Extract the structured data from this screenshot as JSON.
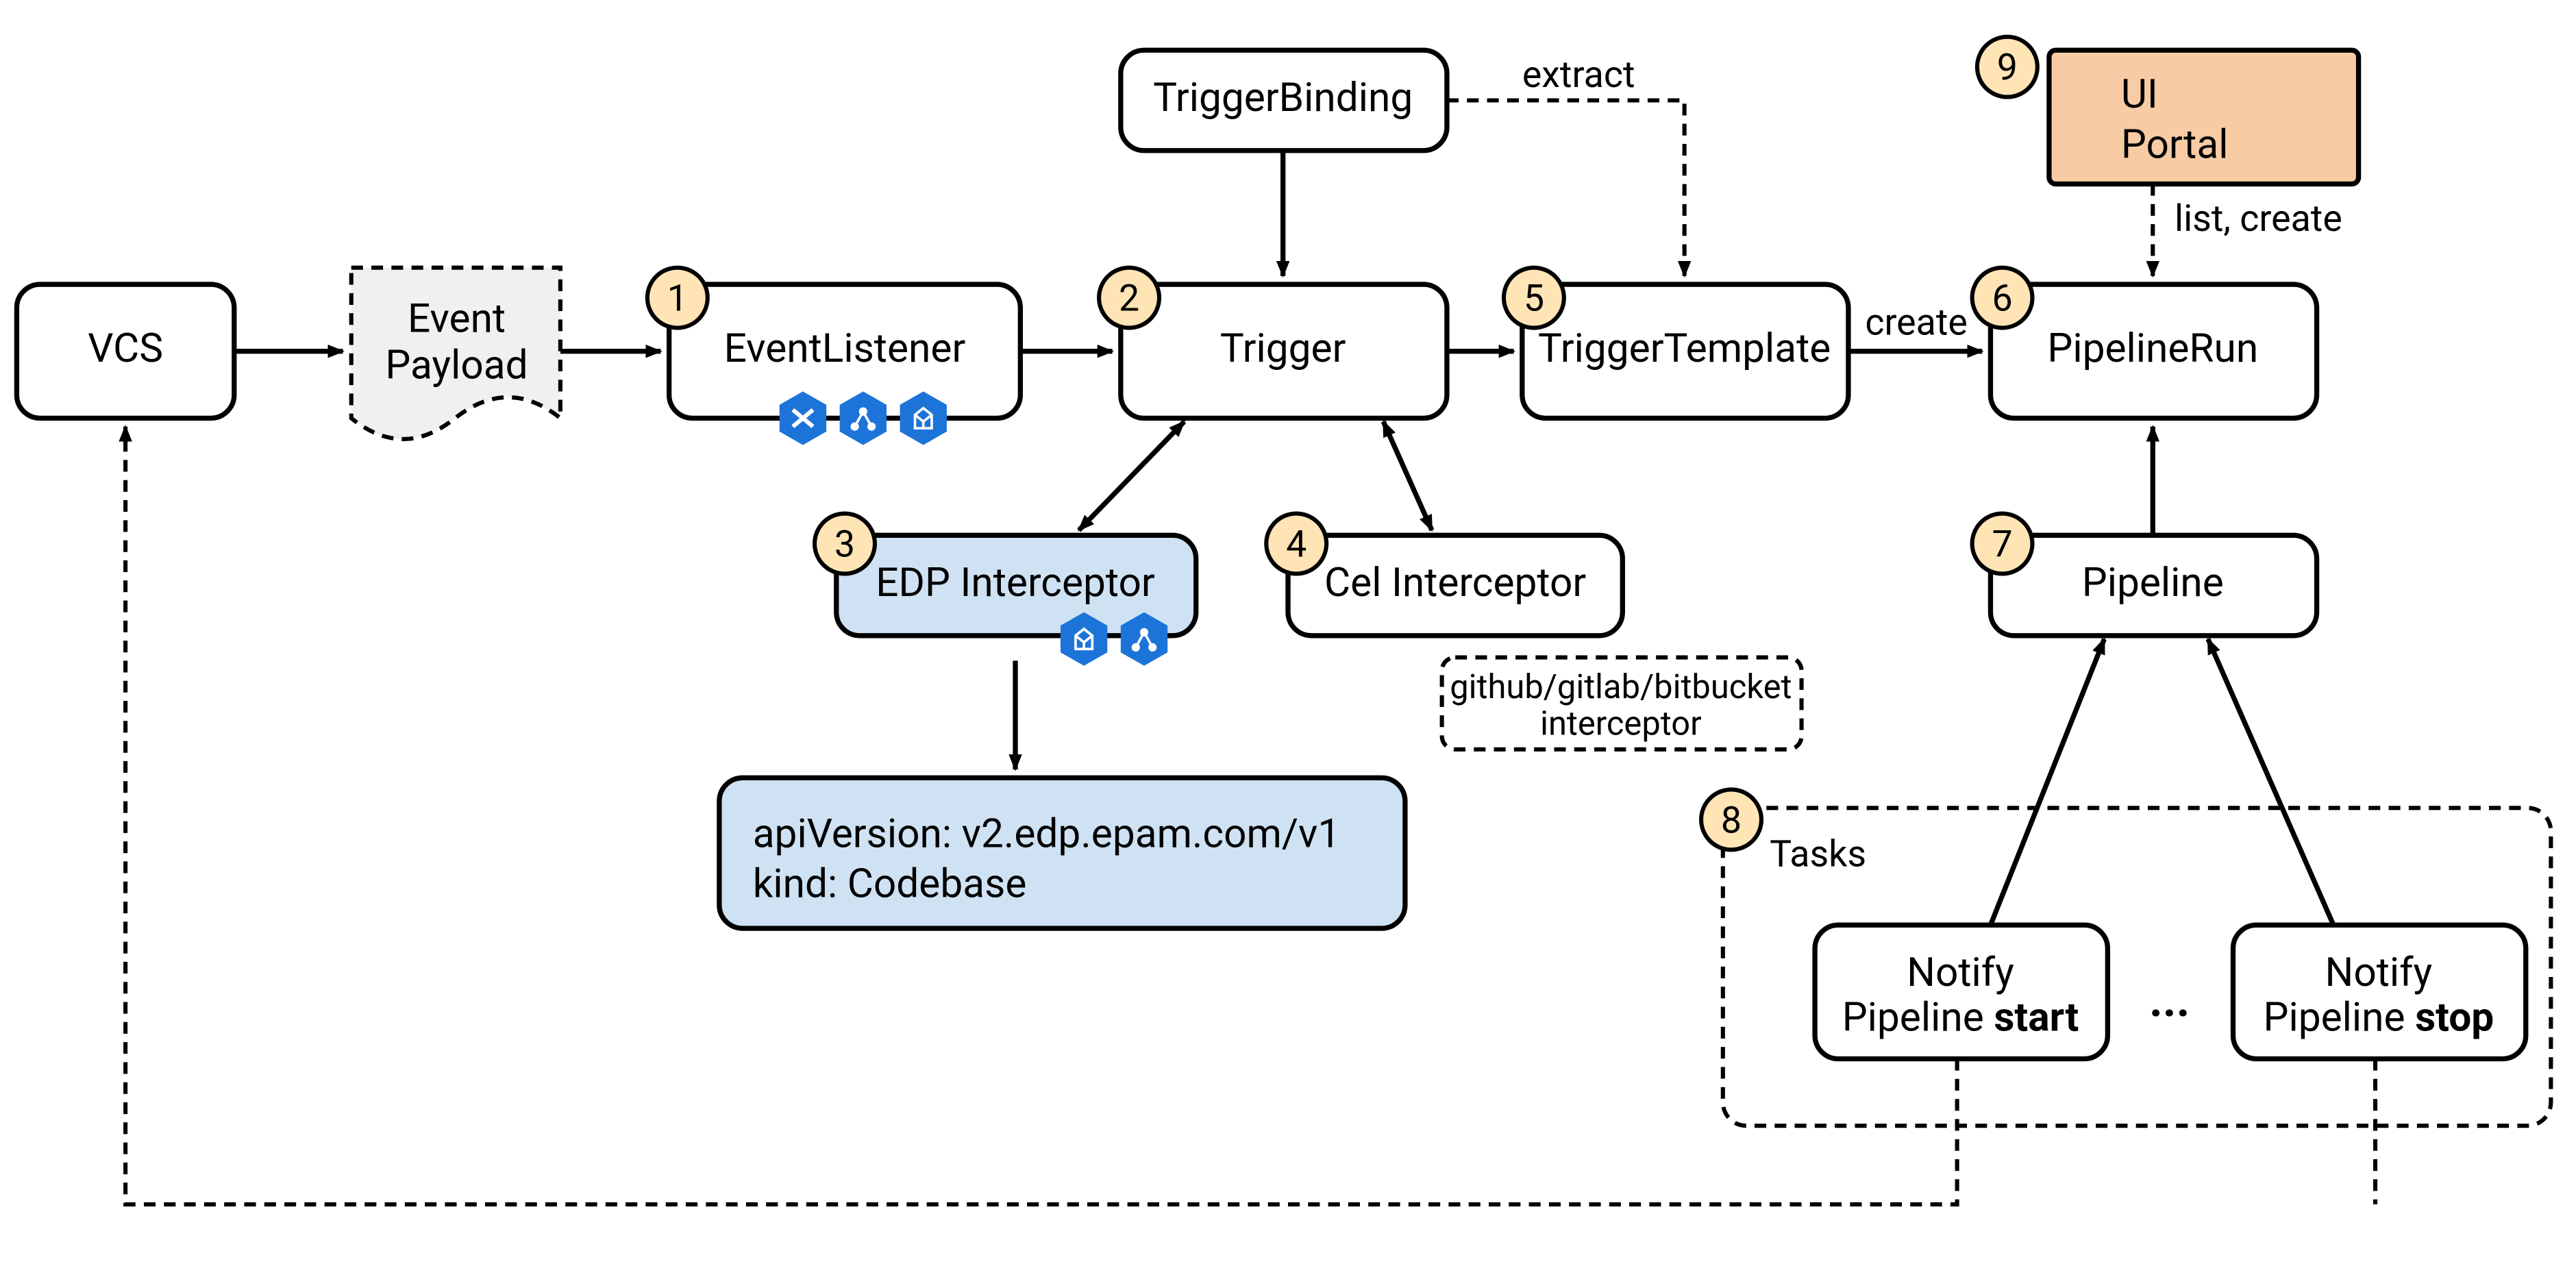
{
  "nodes": {
    "vcs": "VCS",
    "event_payload_l1": "Event",
    "event_payload_l2": "Payload",
    "event_listener": "EventListener",
    "trigger": "Trigger",
    "trigger_binding": "TriggerBinding",
    "trigger_template": "TriggerTemplate",
    "pipeline_run": "PipelineRun",
    "ui_portal_l1": "UI",
    "ui_portal_l2": "Portal",
    "edp_interceptor": "EDP Interceptor",
    "cel_interceptor": "Cel Interceptor",
    "other_interceptor_l1": "github/gitlab/bitbucket",
    "other_interceptor_l2": "interceptor",
    "api_l1": "apiVersion: v2.edp.epam.com/v1",
    "api_l2": "kind: Codebase",
    "pipeline": "Pipeline",
    "notify_start_l1": "Notify",
    "notify_start_l2a": "Pipeline ",
    "notify_start_l2b": "start",
    "notify_stop_l1": "Notify",
    "notify_stop_l2a": "Pipeline ",
    "notify_stop_l2b": "stop",
    "ellipsis": "..."
  },
  "badges": {
    "b1": "1",
    "b2": "2",
    "b3": "3",
    "b4": "4",
    "b5": "5",
    "b6": "6",
    "b7": "7",
    "b8": "8",
    "b9": "9"
  },
  "labels": {
    "extract": "extract",
    "create": "create",
    "list_create": "list, create",
    "tasks": "Tasks"
  }
}
